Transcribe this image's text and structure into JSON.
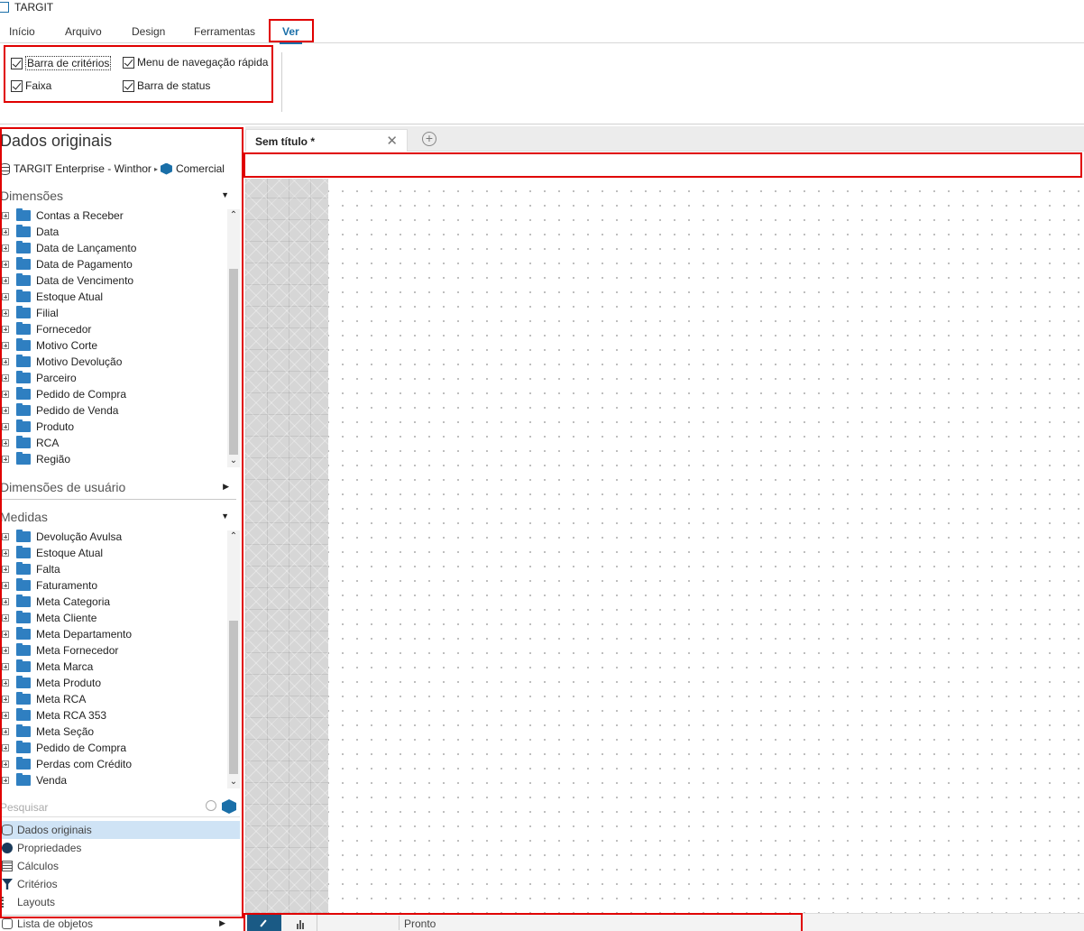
{
  "app": {
    "title": "TARGIT"
  },
  "menu": {
    "items": [
      "Início",
      "Arquivo",
      "Design",
      "Ferramentas",
      "Ver"
    ],
    "active": "Ver"
  },
  "ribbon": {
    "checkboxes": [
      {
        "label": "Barra de critérios",
        "checked": true
      },
      {
        "label": "Faixa",
        "checked": true
      },
      {
        "label": "Menu de navegação rápida",
        "checked": true
      },
      {
        "label": "Barra de status",
        "checked": true
      }
    ]
  },
  "left_panel": {
    "title": "Dados originais",
    "source": {
      "server": "TARGIT Enterprise - Winthor",
      "cube": "Comercial"
    },
    "dimensions": {
      "label": "Dimensões",
      "items": [
        "Contas a Receber",
        "Data",
        "Data de Lançamento",
        "Data de Pagamento",
        "Data de Vencimento",
        "Estoque Atual",
        "Filial",
        "Fornecedor",
        "Motivo Corte",
        "Motivo Devolução",
        "Parceiro",
        "Pedido de Compra",
        "Pedido de Venda",
        "Produto",
        "RCA",
        "Região"
      ]
    },
    "user_dimensions": {
      "label": "Dimensões de usuário"
    },
    "measures": {
      "label": "Medidas",
      "items": [
        "Devolução Avulsa",
        "Estoque Atual",
        "Falta",
        "Faturamento",
        "Meta Categoria",
        "Meta Cliente",
        "Meta Departamento",
        "Meta Fornecedor",
        "Meta Marca",
        "Meta Produto",
        "Meta RCA",
        "Meta RCA 353",
        "Meta Seção",
        "Pedido de Compra",
        "Perdas com Crédito",
        "Venda"
      ]
    },
    "search": {
      "placeholder": "Pesquisar"
    },
    "nav": [
      "Dados originais",
      "Propriedades",
      "Cálculos",
      "Critérios",
      "Layouts"
    ],
    "nav_selected": "Dados originais",
    "object_list": "Lista de objetos"
  },
  "document": {
    "tab_title": "Sem título *"
  },
  "statusbar": {
    "status": "Pronto"
  },
  "colors": {
    "highlight_border": "#e00000",
    "accent": "#1a6fa8",
    "selected_bg": "#cfe3f5"
  },
  "icons": [
    "app-icon",
    "checkbox-icon",
    "database-icon",
    "cube-icon",
    "folder-icon",
    "expand-icon",
    "search-icon",
    "gear-icon",
    "calculator-icon",
    "filter-icon",
    "layout-icon",
    "list-icon",
    "close-icon",
    "add-tab-icon",
    "edit-icon",
    "chart-icon"
  ]
}
